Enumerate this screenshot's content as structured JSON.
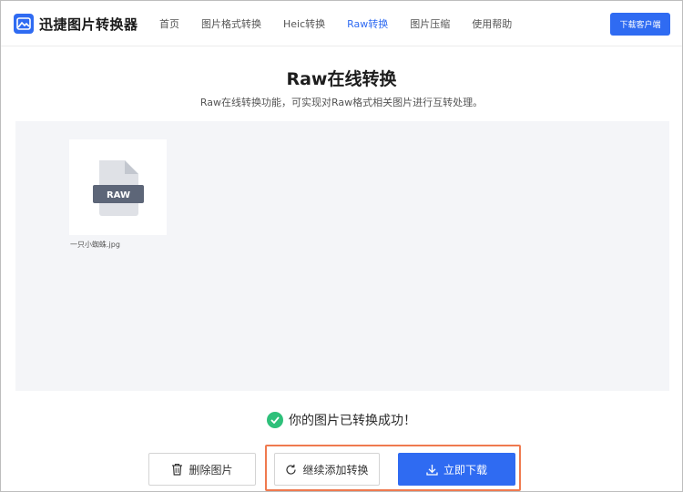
{
  "app": {
    "name": "迅捷图片转换器",
    "logo_icon": "image-icon"
  },
  "nav": {
    "items": [
      {
        "label": "首页"
      },
      {
        "label": "图片格式转换"
      },
      {
        "label": "Heic转换"
      },
      {
        "label": "Raw转换",
        "active": true
      },
      {
        "label": "图片压缩"
      },
      {
        "label": "使用帮助"
      }
    ],
    "download_client_label": "下载客户端"
  },
  "page": {
    "title": "Raw在线转换",
    "subtitle": "Raw在线转换功能，可实现对Raw格式相关图片进行互转处理。"
  },
  "file": {
    "badge": "RAW",
    "name": "一只小蜘蛛.jpg"
  },
  "status": {
    "text": "你的图片已转换成功！",
    "icon": "check-circle-icon"
  },
  "actions": {
    "delete_label": "删除图片",
    "add_label": "继续添加转换",
    "download_label": "立即下载"
  },
  "colors": {
    "accent": "#2f6bf2",
    "success": "#2ec07a",
    "highlight": "#ef7a4f",
    "work_area_bg": "#f4f5f8"
  }
}
